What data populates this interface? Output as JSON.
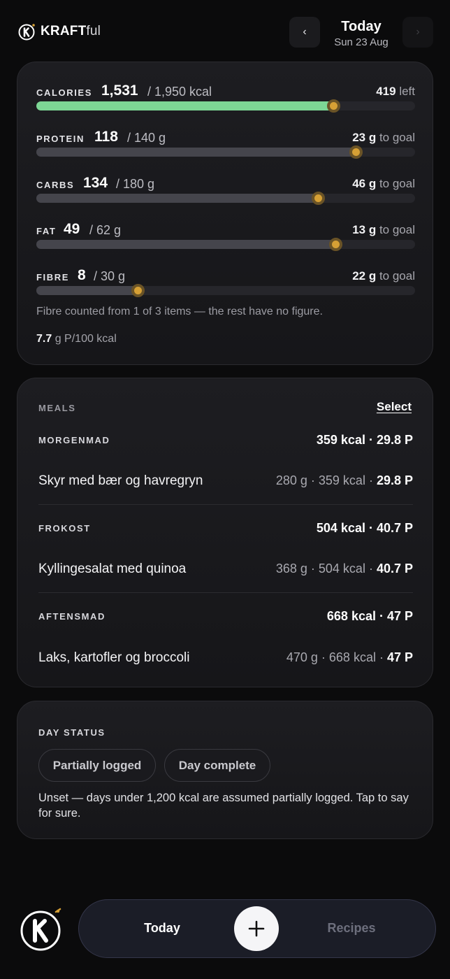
{
  "app": {
    "brand_bold": "KRAFT",
    "brand_light": "ful",
    "logo_letter": "K"
  },
  "header": {
    "prev_icon": "chevron-left-icon",
    "next_icon": "chevron-right-icon",
    "prev_glyph": "‹",
    "next_glyph": "›",
    "title": "Today",
    "date": "Sun 23 Aug"
  },
  "nutrients": [
    {
      "name": "CALORIES",
      "value": "1,531",
      "target": "/ 1,950 kcal",
      "left_value": "419",
      "left_text": "left",
      "progress": 0.785,
      "color": "#7dd695"
    },
    {
      "name": "PROTEIN",
      "value": "118",
      "target": "/ 140 g",
      "left_value": "23 g",
      "left_text": "to goal",
      "progress": 0.843,
      "color": "#45454c"
    },
    {
      "name": "CARBS",
      "value": "134",
      "target": "/ 180 g",
      "left_value": "46 g",
      "left_text": "to goal",
      "progress": 0.744,
      "color": "#45454c"
    },
    {
      "name": "FAT",
      "value": "49",
      "target": "/ 62 g",
      "left_value": "13 g",
      "left_text": "to goal",
      "progress": 0.79,
      "color": "#45454c"
    },
    {
      "name": "FIBRE",
      "value": "8",
      "target": "/ 30 g",
      "left_value": "22 g",
      "left_text": "to goal",
      "progress": 0.267,
      "color": "#45454c"
    }
  ],
  "fibre_note": "Fibre counted from 1 of 3 items — the rest have no figure.",
  "ratio": {
    "value": "7.7",
    "unit": "g P/100 kcal"
  },
  "meals": {
    "label": "MEALS",
    "select_label": "Select",
    "groups": [
      {
        "name": "MORGENMAD",
        "summary": "359 kcal · 29.8 P",
        "item": {
          "name": "Skyr med bær og havregryn",
          "details": "280 g · 359 kcal · ",
          "protein": "29.8 P"
        }
      },
      {
        "name": "FROKOST",
        "summary": "504 kcal · 40.7 P",
        "item": {
          "name": "Kyllingesalat med quinoa",
          "details": "368 g · 504 kcal · ",
          "protein": "40.7 P"
        }
      },
      {
        "name": "AFTENSMAD",
        "summary": "668 kcal · 47 P",
        "item": {
          "name": "Laks, kartofler og broccoli",
          "details": "470 g · 668 kcal · ",
          "protein": "47 P"
        }
      }
    ]
  },
  "day_status": {
    "label": "DAY STATUS",
    "option_partial": "Partially logged",
    "option_complete": "Day complete",
    "help": "Unset — days under 1,200 kcal are assumed partially logged. Tap to say for sure."
  },
  "bottom_nav": {
    "today": "Today",
    "recipes": "Recipes",
    "add_icon": "plus-icon"
  },
  "colors": {
    "accent_green": "#7dd695",
    "knob": "#d6a035",
    "background": "#0b0b0c"
  }
}
